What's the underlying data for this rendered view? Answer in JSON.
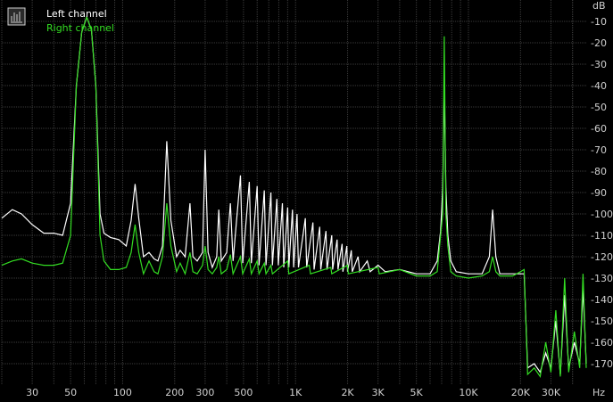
{
  "chart_data": {
    "type": "line",
    "xscale": "log",
    "xlim": [
      20,
      48000
    ],
    "ylim": [
      -180,
      0
    ],
    "ylabel": "dB",
    "xlabel": "Hz",
    "grid": true,
    "legend_position": "top-left",
    "yticks": [
      "-10",
      "-20",
      "-30",
      "-40",
      "-50",
      "-60",
      "-70",
      "-80",
      "-90",
      "-100",
      "-110",
      "-120",
      "-130",
      "-140",
      "-150",
      "-160",
      "-170"
    ],
    "xtick_labels": [
      {
        "label": "30",
        "value": 30
      },
      {
        "label": "50",
        "value": 50
      },
      {
        "label": "100",
        "value": 100
      },
      {
        "label": "200",
        "value": 200
      },
      {
        "label": "300",
        "value": 300
      },
      {
        "label": "500",
        "value": 500
      },
      {
        "label": "1K",
        "value": 1000
      },
      {
        "label": "2K",
        "value": 2000
      },
      {
        "label": "3K",
        "value": 3000
      },
      {
        "label": "5K",
        "value": 5000
      },
      {
        "label": "10K",
        "value": 10000
      },
      {
        "label": "20K",
        "value": 20000
      },
      {
        "label": "30K",
        "value": 30000
      }
    ],
    "series": [
      {
        "name": "Left channel",
        "color": "#ffffff",
        "points": [
          [
            20,
            -102
          ],
          [
            23,
            -98
          ],
          [
            26,
            -100
          ],
          [
            30,
            -105
          ],
          [
            35,
            -109
          ],
          [
            40,
            -109
          ],
          [
            45,
            -110
          ],
          [
            50,
            -95
          ],
          [
            54,
            -40
          ],
          [
            58,
            -15
          ],
          [
            62,
            -8
          ],
          [
            66,
            -14
          ],
          [
            70,
            -40
          ],
          [
            74,
            -100
          ],
          [
            78,
            -109
          ],
          [
            85,
            -111
          ],
          [
            95,
            -112
          ],
          [
            105,
            -115
          ],
          [
            112,
            -103
          ],
          [
            118,
            -86
          ],
          [
            124,
            -102
          ],
          [
            132,
            -120
          ],
          [
            142,
            -118
          ],
          [
            152,
            -121
          ],
          [
            160,
            -122
          ],
          [
            170,
            -115
          ],
          [
            180,
            -66
          ],
          [
            190,
            -103
          ],
          [
            205,
            -120
          ],
          [
            215,
            -117
          ],
          [
            230,
            -120
          ],
          [
            245,
            -95
          ],
          [
            255,
            -120
          ],
          [
            270,
            -122
          ],
          [
            290,
            -118
          ],
          [
            300,
            -70
          ],
          [
            312,
            -118
          ],
          [
            330,
            -125
          ],
          [
            350,
            -120
          ],
          [
            360,
            -98
          ],
          [
            372,
            -122
          ],
          [
            400,
            -118
          ],
          [
            420,
            -95
          ],
          [
            435,
            -122
          ],
          [
            480,
            -82
          ],
          [
            495,
            -123
          ],
          [
            540,
            -85
          ],
          [
            555,
            -123
          ],
          [
            600,
            -87
          ],
          [
            615,
            -124
          ],
          [
            660,
            -89
          ],
          [
            675,
            -124
          ],
          [
            720,
            -90
          ],
          [
            735,
            -124
          ],
          [
            780,
            -93
          ],
          [
            795,
            -124
          ],
          [
            840,
            -95
          ],
          [
            855,
            -125
          ],
          [
            900,
            -97
          ],
          [
            915,
            -125
          ],
          [
            960,
            -98
          ],
          [
            975,
            -125
          ],
          [
            1020,
            -100
          ],
          [
            1040,
            -125
          ],
          [
            1140,
            -102
          ],
          [
            1160,
            -125
          ],
          [
            1260,
            -104
          ],
          [
            1280,
            -126
          ],
          [
            1380,
            -106
          ],
          [
            1400,
            -126
          ],
          [
            1500,
            -108
          ],
          [
            1520,
            -126
          ],
          [
            1620,
            -110
          ],
          [
            1640,
            -126
          ],
          [
            1740,
            -112
          ],
          [
            1760,
            -126
          ],
          [
            1860,
            -114
          ],
          [
            1880,
            -127
          ],
          [
            1980,
            -115
          ],
          [
            2000,
            -127
          ],
          [
            2100,
            -117
          ],
          [
            2130,
            -127
          ],
          [
            2300,
            -120
          ],
          [
            2350,
            -127
          ],
          [
            2600,
            -122
          ],
          [
            2700,
            -127
          ],
          [
            3000,
            -124
          ],
          [
            3300,
            -127
          ],
          [
            4000,
            -126
          ],
          [
            5000,
            -128
          ],
          [
            6000,
            -128
          ],
          [
            6600,
            -122
          ],
          [
            6900,
            -108
          ],
          [
            7100,
            -88
          ],
          [
            7250,
            -40
          ],
          [
            7400,
            -88
          ],
          [
            7600,
            -110
          ],
          [
            7900,
            -122
          ],
          [
            8500,
            -127
          ],
          [
            10000,
            -128
          ],
          [
            12000,
            -128
          ],
          [
            13200,
            -120
          ],
          [
            13800,
            -98
          ],
          [
            14400,
            -120
          ],
          [
            15200,
            -128
          ],
          [
            18000,
            -128
          ],
          [
            20000,
            -128
          ],
          [
            21000,
            -128
          ],
          [
            21500,
            -150
          ],
          [
            22000,
            -172
          ],
          [
            24000,
            -170
          ],
          [
            26000,
            -174
          ],
          [
            28000,
            -165
          ],
          [
            30000,
            -172
          ],
          [
            32000,
            -150
          ],
          [
            34000,
            -175
          ],
          [
            36000,
            -138
          ],
          [
            38000,
            -172
          ],
          [
            41000,
            -160
          ],
          [
            44000,
            -170
          ],
          [
            46000,
            -135
          ],
          [
            48000,
            -170
          ]
        ]
      },
      {
        "name": "Right channel",
        "color": "#33dd22",
        "points": [
          [
            20,
            -124
          ],
          [
            23,
            -122
          ],
          [
            26,
            -121
          ],
          [
            30,
            -123
          ],
          [
            35,
            -124
          ],
          [
            40,
            -124
          ],
          [
            45,
            -123
          ],
          [
            50,
            -110
          ],
          [
            54,
            -40
          ],
          [
            58,
            -15
          ],
          [
            62,
            -8
          ],
          [
            66,
            -14
          ],
          [
            70,
            -40
          ],
          [
            74,
            -110
          ],
          [
            78,
            -122
          ],
          [
            85,
            -126
          ],
          [
            95,
            -126
          ],
          [
            105,
            -125
          ],
          [
            112,
            -118
          ],
          [
            118,
            -105
          ],
          [
            124,
            -118
          ],
          [
            132,
            -128
          ],
          [
            142,
            -122
          ],
          [
            152,
            -127
          ],
          [
            160,
            -128
          ],
          [
            170,
            -120
          ],
          [
            180,
            -95
          ],
          [
            190,
            -115
          ],
          [
            205,
            -127
          ],
          [
            215,
            -123
          ],
          [
            230,
            -128
          ],
          [
            245,
            -118
          ],
          [
            255,
            -127
          ],
          [
            270,
            -128
          ],
          [
            290,
            -124
          ],
          [
            300,
            -115
          ],
          [
            312,
            -126
          ],
          [
            330,
            -128
          ],
          [
            350,
            -125
          ],
          [
            360,
            -120
          ],
          [
            372,
            -128
          ],
          [
            400,
            -126
          ],
          [
            420,
            -119
          ],
          [
            435,
            -128
          ],
          [
            480,
            -120
          ],
          [
            495,
            -128
          ],
          [
            540,
            -121
          ],
          [
            555,
            -128
          ],
          [
            600,
            -122
          ],
          [
            615,
            -128
          ],
          [
            660,
            -123
          ],
          [
            675,
            -128
          ],
          [
            720,
            -124
          ],
          [
            735,
            -128
          ],
          [
            900,
            -122
          ],
          [
            915,
            -128
          ],
          [
            1200,
            -124
          ],
          [
            1220,
            -128
          ],
          [
            1600,
            -125
          ],
          [
            1620,
            -128
          ],
          [
            2000,
            -124
          ],
          [
            2020,
            -128
          ],
          [
            3000,
            -125
          ],
          [
            3050,
            -128
          ],
          [
            4000,
            -126
          ],
          [
            5000,
            -129
          ],
          [
            6000,
            -129
          ],
          [
            6600,
            -127
          ],
          [
            6900,
            -110
          ],
          [
            7100,
            -100
          ],
          [
            7250,
            -17
          ],
          [
            7400,
            -100
          ],
          [
            7600,
            -115
          ],
          [
            7900,
            -127
          ],
          [
            8500,
            -129
          ],
          [
            10000,
            -130
          ],
          [
            12000,
            -129
          ],
          [
            13200,
            -127
          ],
          [
            13800,
            -120
          ],
          [
            14400,
            -127
          ],
          [
            15200,
            -129
          ],
          [
            18000,
            -129
          ],
          [
            20000,
            -127
          ],
          [
            21000,
            -126
          ],
          [
            21500,
            -150
          ],
          [
            22000,
            -175
          ],
          [
            24000,
            -172
          ],
          [
            26000,
            -176
          ],
          [
            28000,
            -160
          ],
          [
            30000,
            -174
          ],
          [
            32000,
            -145
          ],
          [
            34000,
            -176
          ],
          [
            36000,
            -130
          ],
          [
            38000,
            -174
          ],
          [
            41000,
            -155
          ],
          [
            44000,
            -172
          ],
          [
            46000,
            -128
          ],
          [
            48000,
            -172
          ]
        ]
      }
    ]
  }
}
